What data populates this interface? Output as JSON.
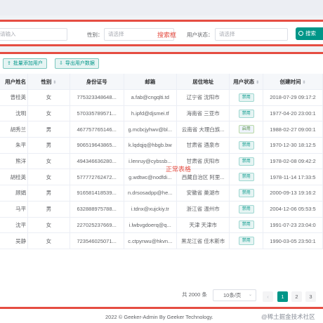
{
  "search": {
    "name_placeholder": "请输入",
    "gender_label": "性别：",
    "gender_placeholder": "请选择",
    "status_label": "用户状态：",
    "status_placeholder": "请选择",
    "search_button": "搜索",
    "annotation": "搜索框"
  },
  "toolbar": {
    "batch_add": "批量添加用户",
    "export": "导出用户数据"
  },
  "table": {
    "annotation": "正常表格",
    "columns": [
      "用户姓名",
      "性别",
      "身份证号",
      "邮箱",
      "居住地址",
      "用户状态",
      "创建时间"
    ],
    "rows": [
      [
        "曾桂英",
        "女",
        "775323348648...",
        "a.fab@cngqlti.td",
        "辽宁省 沈阳市",
        "禁用",
        "2018-07-29 09:17:2"
      ],
      [
        "沈明",
        "女",
        "570335789571...",
        "h.ipfd@djsmei.tf",
        "海南省 三亚市",
        "禁用",
        "1977-04-20 23:00:1"
      ],
      [
        "胡秀兰",
        "男",
        "467757765146...",
        "g.mcbcjyhwv@bl...",
        "云南省 大理白族...",
        "启用",
        "1988-02-27 09:00:1"
      ],
      [
        "朱平",
        "男",
        "906519643865...",
        "k.lqdqjq@hbgb.bw",
        "甘肃省 酒泉市",
        "禁用",
        "1970-12-30 18:12:5"
      ],
      [
        "熊洋",
        "女",
        "494346636280...",
        "i.lenruy@cybssb...",
        "甘肃省 庆阳市",
        "禁用",
        "1978-02-08 09:42:2"
      ],
      [
        "胡桂英",
        "女",
        "577772762472...",
        "g.wdtwc@nodfdi...",
        "西藏自治区 阿里...",
        "禁用",
        "1978-11-14 17:33:5"
      ],
      [
        "顾娟",
        "男",
        "916581418539...",
        "n.drsosadpp@he...",
        "安徽省 巢湖市",
        "禁用",
        "2000-09-13 19:16:2"
      ],
      [
        "马平",
        "男",
        "632888975788...",
        "i.tdnx@xujckiy.tr",
        "浙江省 温州市",
        "禁用",
        "2004-12-06 05:53:5"
      ],
      [
        "沈平",
        "女",
        "227025237669...",
        "i.lwbvgdoerq@q...",
        "天津 天津市",
        "禁用",
        "1991-07-23 23:04:0"
      ],
      [
        "吴静",
        "女",
        "723546025071...",
        "c.ctpynwu@hkvn...",
        "黑龙江省 佳木斯市",
        "禁用",
        "1990-03-05 23:50:1"
      ]
    ]
  },
  "pagination": {
    "total": "共 2000 条",
    "page_size": "10条/页",
    "pages": [
      "1",
      "2",
      "3"
    ],
    "current": "1"
  },
  "footer": {
    "copyright": "2022 © Geeker-Admin By Geeker Technology.",
    "watermark": "@稀土掘金技术社区"
  },
  "colors": {
    "accent": "#009688",
    "annotation_red": "#e54d42"
  }
}
